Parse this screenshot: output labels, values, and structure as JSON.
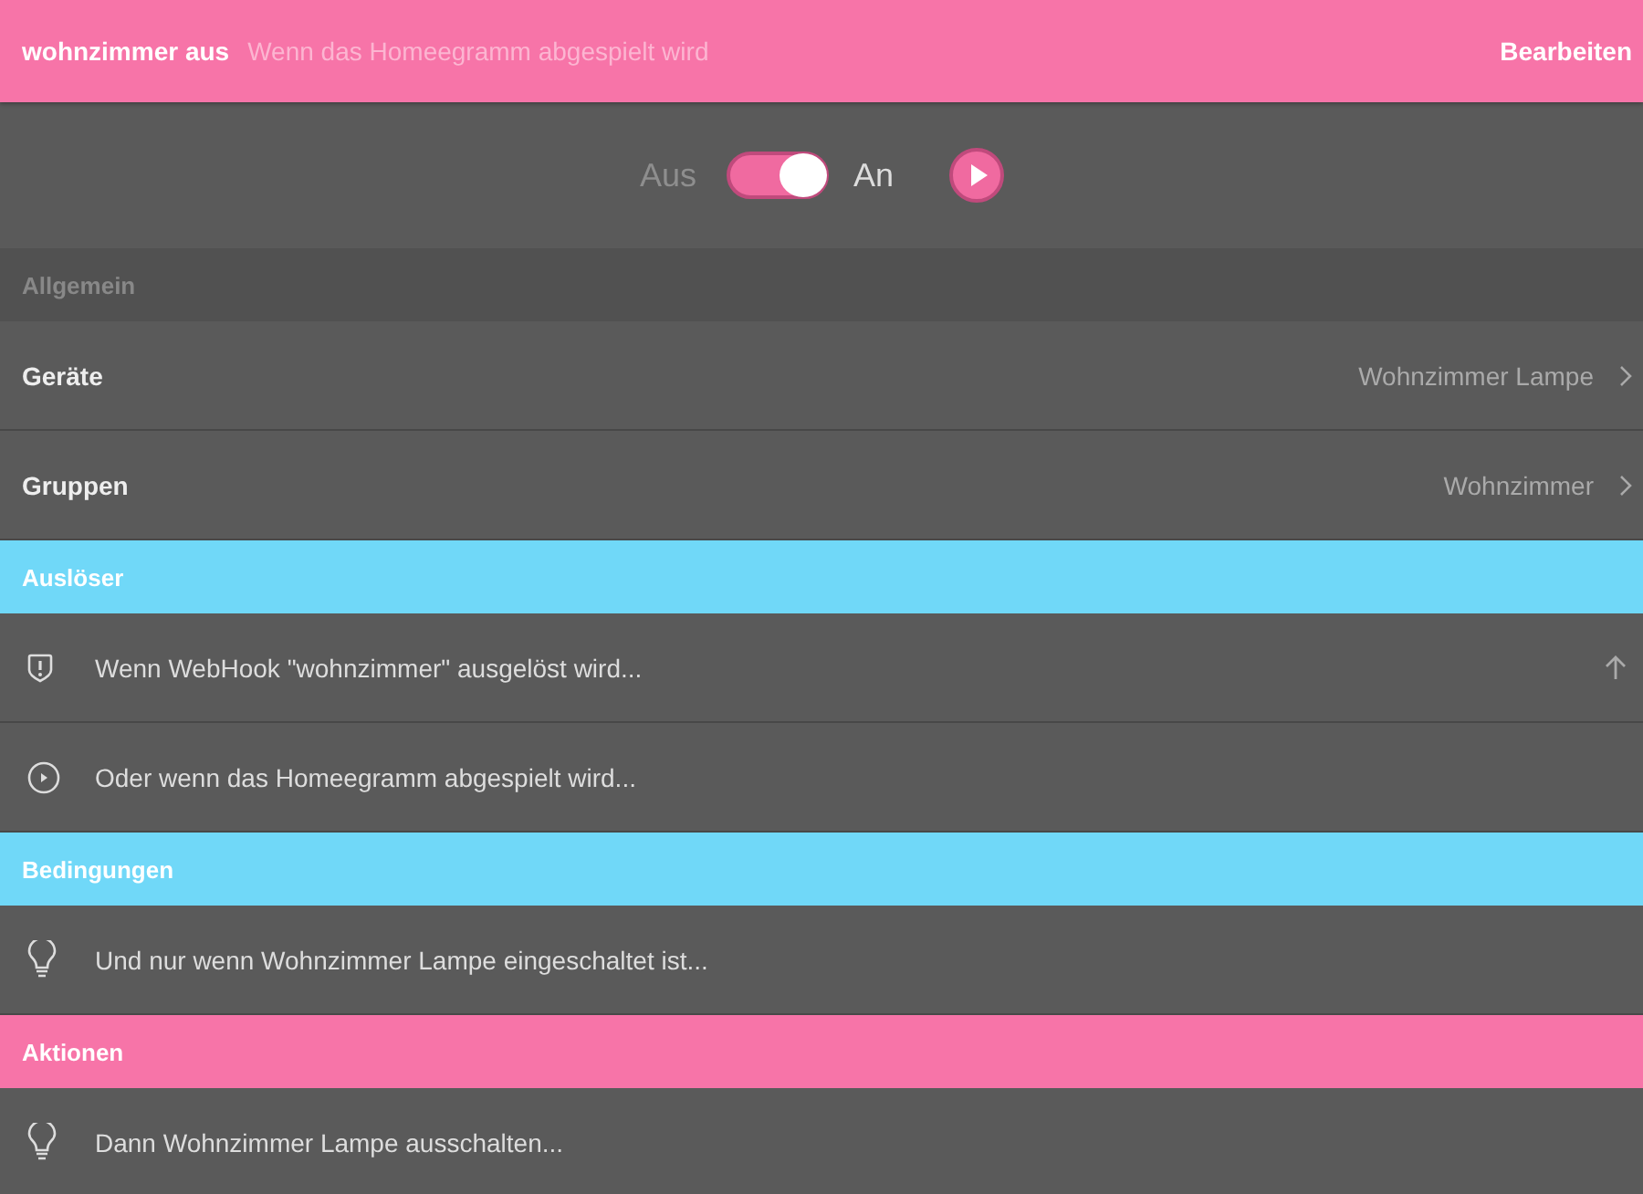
{
  "header": {
    "title": "wohnzimmer aus",
    "subtitle": "Wenn das Homeegramm abgespielt wird",
    "edit": "Bearbeiten"
  },
  "toggle": {
    "off_label": "Aus",
    "on_label": "An",
    "on": true
  },
  "sections": [
    {
      "title": "Allgemein",
      "kind": "plain",
      "rows": [
        {
          "kind": "nav",
          "label": "Geräte",
          "value": "Wohnzimmer Lampe"
        },
        {
          "kind": "nav",
          "label": "Gruppen",
          "value": "Wohnzimmer"
        }
      ]
    },
    {
      "title": "Auslöser",
      "kind": "accent",
      "color": "#70d8f8",
      "rows": [
        {
          "kind": "webhook",
          "text": "Wenn WebHook \"wohnzimmer\" ausgelöst wird...",
          "move_up": true
        },
        {
          "kind": "play",
          "text": "Oder wenn das Homeegramm abgespielt wird...",
          "move_up": false
        }
      ]
    },
    {
      "title": "Bedingungen",
      "kind": "accent",
      "color": "#70d8f8",
      "rows": [
        {
          "kind": "device",
          "text": "Und nur wenn Wohnzimmer Lampe eingeschaltet ist...",
          "move_up": false
        }
      ]
    },
    {
      "title": "Aktionen",
      "kind": "accent",
      "color": "#f774a8",
      "rows": [
        {
          "kind": "device",
          "text": "Dann Wohnzimmer Lampe ausschalten...",
          "move_up": false
        }
      ]
    }
  ]
}
